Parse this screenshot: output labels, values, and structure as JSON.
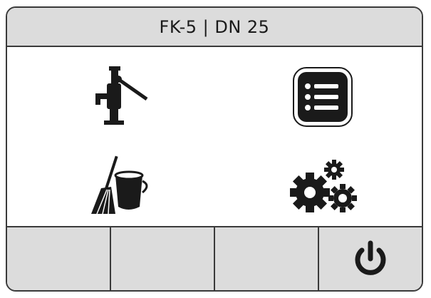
{
  "header": {
    "title": "FK-5 | DN 25"
  },
  "menu": {
    "items": [
      {
        "id": "manual-operation",
        "icon": "hand-pump-icon"
      },
      {
        "id": "list-view",
        "icon": "list-icon"
      },
      {
        "id": "cleaning",
        "icon": "broom-bucket-icon"
      },
      {
        "id": "settings",
        "icon": "gears-icon"
      }
    ]
  },
  "footer": {
    "buttons": [
      {
        "id": "softkey-1",
        "icon": ""
      },
      {
        "id": "softkey-2",
        "icon": ""
      },
      {
        "id": "softkey-3",
        "icon": ""
      },
      {
        "id": "power",
        "icon": "power-icon"
      }
    ]
  },
  "colors": {
    "header_bg": "#dcdcdc",
    "border": "#3a3a3a",
    "icon": "#1a1a1a",
    "background": "#ffffff"
  }
}
